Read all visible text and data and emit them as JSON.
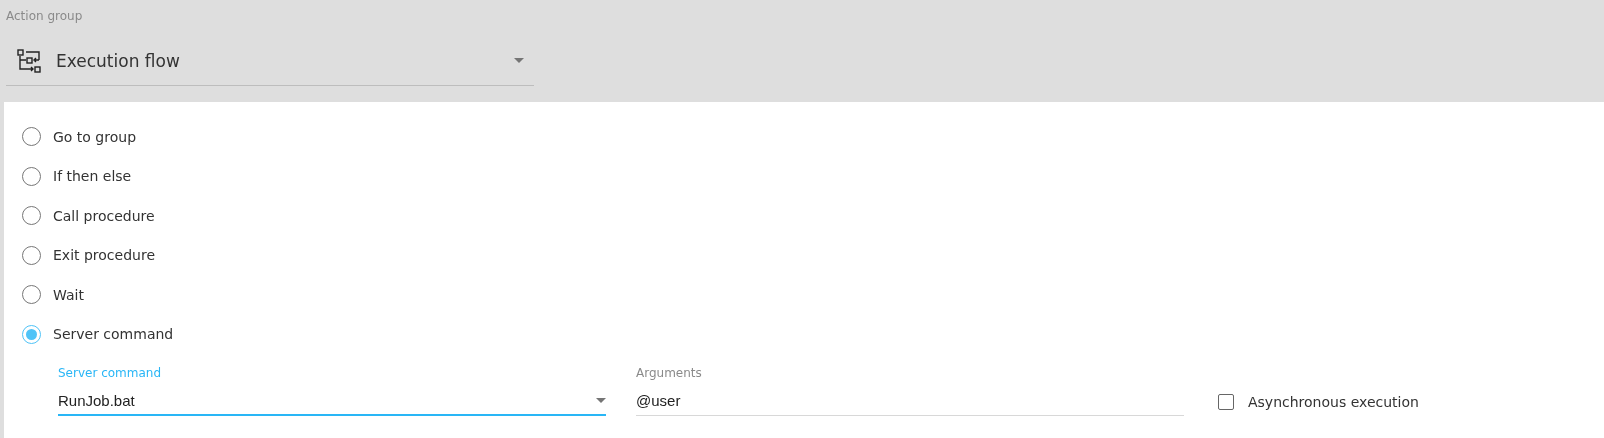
{
  "action_group": {
    "label": "Action group",
    "value": "Execution flow"
  },
  "options": [
    {
      "label": "Go to group",
      "selected": false
    },
    {
      "label": "If then else",
      "selected": false
    },
    {
      "label": "Call procedure",
      "selected": false
    },
    {
      "label": "Exit procedure",
      "selected": false
    },
    {
      "label": "Wait",
      "selected": false
    },
    {
      "label": "Server command",
      "selected": true
    }
  ],
  "server_command": {
    "label": "Server command",
    "value": "RunJob.bat"
  },
  "arguments": {
    "label": "Arguments",
    "value": "@user"
  },
  "asynchronous_execution": {
    "label": "Asynchronous execution",
    "checked": false
  }
}
